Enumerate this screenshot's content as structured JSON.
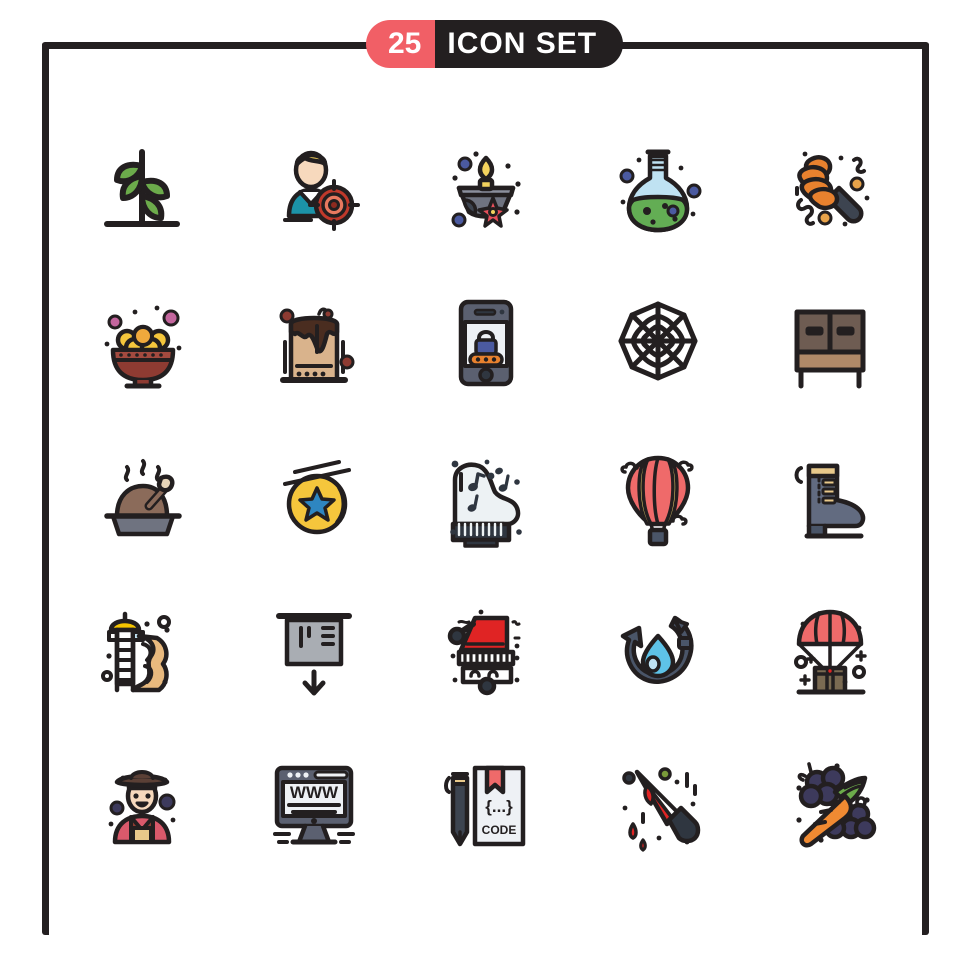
{
  "header": {
    "count": "25",
    "title": "ICON SET"
  },
  "colors": {
    "badge_count_bg": "#f15f66",
    "badge_title_bg": "#231f20",
    "frame_stroke": "#231f20",
    "background": "#ffffff",
    "outline": "#231f20",
    "green_leaf": "#6cab4b",
    "teal": "#1c93a8",
    "skin": "#f7d9bd",
    "hair_yellow": "#f4d35e",
    "target_red": "#c0392b",
    "lamp_gray": "#6f7380",
    "flower_red": "#e8505b",
    "flask_green": "#63ad54",
    "flask_glass": "#bfe2f2",
    "blue_dot": "#4b5aa0",
    "honey_orange": "#e8812e",
    "handle_dark": "#3d4450",
    "bowl_red": "#8e3b32",
    "laddoo_yellow": "#f5c63c",
    "pink_dot": "#c4669e",
    "cake_cream": "#d9b38c",
    "cake_choc": "#4a2d20",
    "phone_body": "#5b6070",
    "phone_screen": "#eef1f5",
    "orange_pill": "#e8812e",
    "wood_brown": "#6e5c52",
    "wood_light": "#b08968",
    "turkey_brown": "#8b6b5a",
    "plate_gray": "#6f7380",
    "coin_gold": "#f5c63c",
    "star_blue": "#2e86c1",
    "piano_white": "#edf2f4",
    "piano_dark": "#2f3640",
    "balloon_red": "#ef6a6a",
    "balloon_yellow": "#f5d76e",
    "boot_gray": "#626b80",
    "boot_tan": "#e8c88a",
    "slide_yellow": "#f5c400",
    "slide_tan": "#e8b97e",
    "screen_gray": "#a9adb3",
    "wash_red": "#e02424",
    "water_blue": "#5ec3e8",
    "recycle_slate": "#4a5568",
    "parachute_red": "#ef6a6a",
    "box_brown": "#7a6a52",
    "farmer_red": "#d9596b",
    "farmer_hat": "#5b4036",
    "monitor_slate": "#5b6070",
    "monitor_screen": "#eef1f5",
    "doc_paper": "#eef1f5",
    "pencil_dark": "#3d4450",
    "knife_red": "#e02424",
    "carrot_orange": "#f08a32",
    "grape_purple": "#3d3a5c",
    "grape_leaf_green": "#6cab4b"
  },
  "grid": {
    "rows": 5,
    "columns": 5,
    "total": 25,
    "icons": [
      {
        "id": 1,
        "name": "plant-sprout-icon",
        "label": "Plant Sprout"
      },
      {
        "id": 2,
        "name": "target-audience-icon",
        "label": "Target Audience"
      },
      {
        "id": 3,
        "name": "diya-lamp-icon",
        "label": "Diya Lamp"
      },
      {
        "id": 4,
        "name": "chemistry-flask-icon",
        "label": "Chemistry Flask"
      },
      {
        "id": 5,
        "name": "honey-dipper-icon",
        "label": "Honey Dipper"
      },
      {
        "id": 6,
        "name": "sweets-bowl-icon",
        "label": "Sweets Bowl"
      },
      {
        "id": 7,
        "name": "chocolate-cake-icon",
        "label": "Chocolate Cake"
      },
      {
        "id": 8,
        "name": "mobile-password-icon",
        "label": "Mobile Password"
      },
      {
        "id": 9,
        "name": "spider-web-icon",
        "label": "Spider Web"
      },
      {
        "id": 10,
        "name": "cabinet-drawers-icon",
        "label": "Cabinet Drawers"
      },
      {
        "id": 11,
        "name": "roast-turkey-icon",
        "label": "Roast Turkey"
      },
      {
        "id": 12,
        "name": "star-coin-icon",
        "label": "Star Coin"
      },
      {
        "id": 13,
        "name": "grand-piano-icon",
        "label": "Grand Piano"
      },
      {
        "id": 14,
        "name": "hot-air-balloon-icon",
        "label": "Hot Air Balloon"
      },
      {
        "id": 15,
        "name": "boot-icon",
        "label": "Boot"
      },
      {
        "id": 16,
        "name": "playground-slide-icon",
        "label": "Playground Slide"
      },
      {
        "id": 17,
        "name": "projector-screen-icon",
        "label": "Projector Screen"
      },
      {
        "id": 18,
        "name": "car-wash-icon",
        "label": "Car Wash"
      },
      {
        "id": 19,
        "name": "water-recycle-icon",
        "label": "Water Recycle"
      },
      {
        "id": 20,
        "name": "parachute-delivery-icon",
        "label": "Parachute Delivery"
      },
      {
        "id": 21,
        "name": "farmer-icon",
        "label": "Farmer"
      },
      {
        "id": 22,
        "name": "website-monitor-icon",
        "label": "Website Monitor"
      },
      {
        "id": 23,
        "name": "code-document-icon",
        "label": "Code Document"
      },
      {
        "id": 24,
        "name": "bloody-knife-icon",
        "label": "Bloody Knife"
      },
      {
        "id": 25,
        "name": "carrot-grapes-icon",
        "label": "Carrot and Grapes"
      }
    ]
  },
  "icon_text": {
    "monitor_www": "WWW",
    "code_label": "CODE",
    "code_braces": "{...}"
  }
}
